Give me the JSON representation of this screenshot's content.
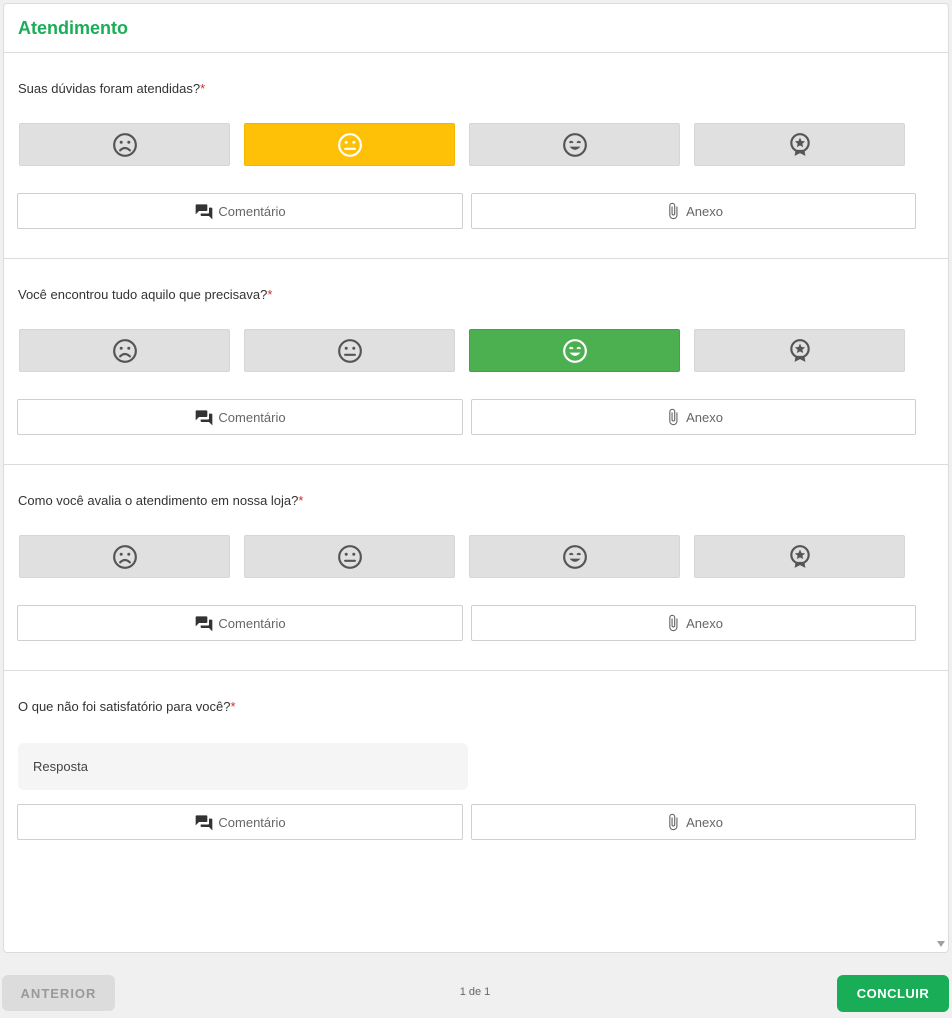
{
  "header": {
    "title": "Atendimento"
  },
  "questions": [
    {
      "text": "Suas dúvidas foram atendidas?",
      "required_mark": "*",
      "selected": 1
    },
    {
      "text": "Você encontrou tudo aquilo que precisava?",
      "required_mark": "*",
      "selected": 2
    },
    {
      "text": "Como você avalia o atendimento em nossa loja?",
      "required_mark": "*",
      "selected": null
    },
    {
      "text": "O que não foi satisfatório para você?",
      "required_mark": "*",
      "input_placeholder": "Resposta",
      "input_value": ""
    }
  ],
  "rating_options": [
    "sad-face-icon",
    "neutral-face-icon",
    "happy-face-icon",
    "star-badge-icon"
  ],
  "actions": {
    "comment_label": "Comentário",
    "attach_label": "Anexo"
  },
  "footer": {
    "prev_label": "ANTERIOR",
    "pager": "1 de 1",
    "next_label": "CONCLUIR"
  },
  "colors": {
    "accent": "#1aad57",
    "selected_yellow": "#ffc107",
    "selected_green": "#4caf50",
    "required": "#d32f2f"
  }
}
